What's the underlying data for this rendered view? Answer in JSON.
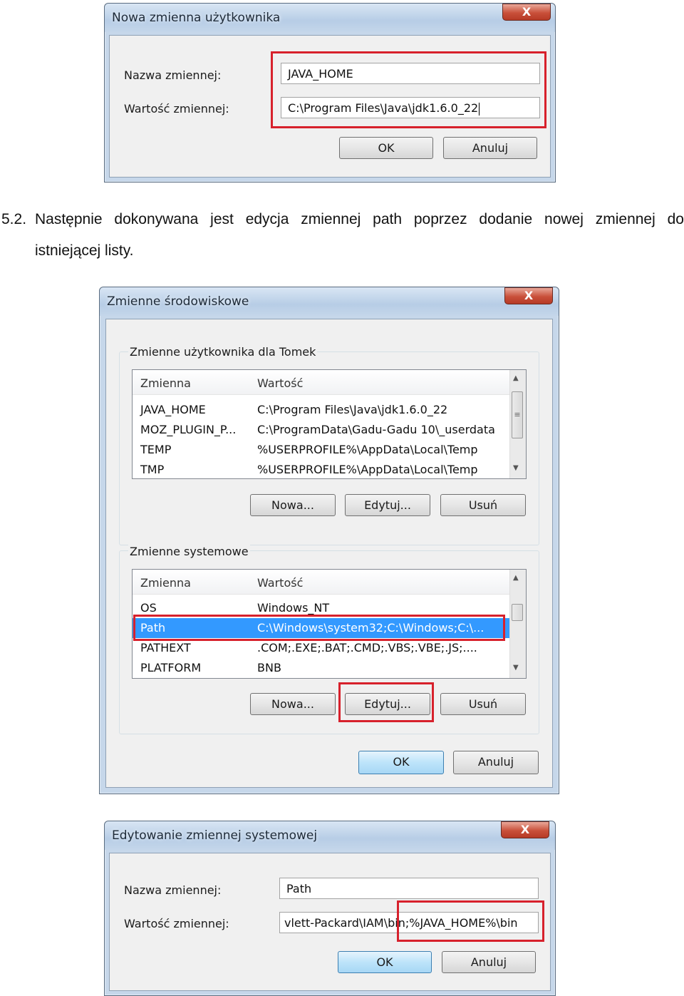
{
  "dialog1": {
    "title": "Nowa zmienna użytkownika",
    "close": "X",
    "name_label": "Nazwa zmiennej:",
    "value_label": "Wartość zmiennej:",
    "name_value": "JAVA_HOME",
    "value_value": "C:\\Program Files\\Java\\jdk1.6.0_22",
    "ok": "OK",
    "cancel": "Anuluj"
  },
  "paragraph": {
    "number": "5.2.",
    "words": [
      "Następnie",
      "dokonywana",
      "jest",
      "edycja",
      "zmiennej",
      "path",
      "poprzez",
      "dodanie",
      "nowej",
      "zmiennej",
      "do"
    ],
    "line2": "istniejącej listy."
  },
  "dialog2": {
    "title": "Zmienne środowiskowe",
    "close": "X",
    "user_group": "Zmienne użytkownika dla Tomek",
    "system_group": "Zmienne systemowe",
    "col_name": "Zmienna",
    "col_value": "Wartość",
    "user_rows": [
      {
        "name": "JAVA_HOME",
        "value": "C:\\Program Files\\Java\\jdk1.6.0_22"
      },
      {
        "name": "MOZ_PLUGIN_P...",
        "value": "C:\\ProgramData\\Gadu-Gadu 10\\_userdata"
      },
      {
        "name": "TEMP",
        "value": "%USERPROFILE%\\AppData\\Local\\Temp"
      },
      {
        "name": "TMP",
        "value": "%USERPROFILE%\\AppData\\Local\\Temp"
      }
    ],
    "system_rows": [
      {
        "name": "OS",
        "value": "Windows_NT"
      },
      {
        "name": "Path",
        "value": "C:\\Windows\\system32;C:\\Windows;C:\\..."
      },
      {
        "name": "PATHEXT",
        "value": ".COM;.EXE;.BAT;.CMD;.VBS;.VBE;.JS;...."
      },
      {
        "name": "PLATFORM",
        "value": "BNB"
      }
    ],
    "btn_new": "Nowa...",
    "btn_edit": "Edytuj...",
    "btn_delete": "Usuń",
    "ok": "OK",
    "cancel": "Anuluj"
  },
  "dialog3": {
    "title": "Edytowanie zmiennej systemowej",
    "close": "X",
    "name_label": "Nazwa zmiennej:",
    "value_label": "Wartość zmiennej:",
    "name_value": "Path",
    "value_value": "vlett-Packard\\IAM\\bin;%JAVA_HOME%\\bin",
    "ok": "OK",
    "cancel": "Anuluj"
  },
  "colors": {
    "highlight_box": "#d7212c",
    "selection": "#3399ff"
  }
}
